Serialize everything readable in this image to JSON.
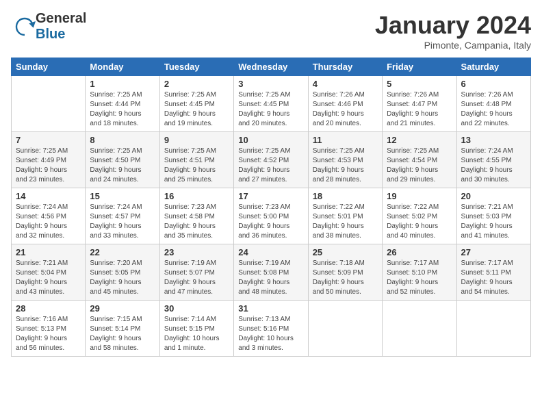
{
  "header": {
    "logo_general": "General",
    "logo_blue": "Blue",
    "month_title": "January 2024",
    "location": "Pimonte, Campania, Italy"
  },
  "days_of_week": [
    "Sunday",
    "Monday",
    "Tuesday",
    "Wednesday",
    "Thursday",
    "Friday",
    "Saturday"
  ],
  "weeks": [
    [
      {
        "day": "",
        "info": ""
      },
      {
        "day": "1",
        "info": "Sunrise: 7:25 AM\nSunset: 4:44 PM\nDaylight: 9 hours\nand 18 minutes."
      },
      {
        "day": "2",
        "info": "Sunrise: 7:25 AM\nSunset: 4:45 PM\nDaylight: 9 hours\nand 19 minutes."
      },
      {
        "day": "3",
        "info": "Sunrise: 7:25 AM\nSunset: 4:45 PM\nDaylight: 9 hours\nand 20 minutes."
      },
      {
        "day": "4",
        "info": "Sunrise: 7:26 AM\nSunset: 4:46 PM\nDaylight: 9 hours\nand 20 minutes."
      },
      {
        "day": "5",
        "info": "Sunrise: 7:26 AM\nSunset: 4:47 PM\nDaylight: 9 hours\nand 21 minutes."
      },
      {
        "day": "6",
        "info": "Sunrise: 7:26 AM\nSunset: 4:48 PM\nDaylight: 9 hours\nand 22 minutes."
      }
    ],
    [
      {
        "day": "7",
        "info": "Sunrise: 7:25 AM\nSunset: 4:49 PM\nDaylight: 9 hours\nand 23 minutes."
      },
      {
        "day": "8",
        "info": "Sunrise: 7:25 AM\nSunset: 4:50 PM\nDaylight: 9 hours\nand 24 minutes."
      },
      {
        "day": "9",
        "info": "Sunrise: 7:25 AM\nSunset: 4:51 PM\nDaylight: 9 hours\nand 25 minutes."
      },
      {
        "day": "10",
        "info": "Sunrise: 7:25 AM\nSunset: 4:52 PM\nDaylight: 9 hours\nand 27 minutes."
      },
      {
        "day": "11",
        "info": "Sunrise: 7:25 AM\nSunset: 4:53 PM\nDaylight: 9 hours\nand 28 minutes."
      },
      {
        "day": "12",
        "info": "Sunrise: 7:25 AM\nSunset: 4:54 PM\nDaylight: 9 hours\nand 29 minutes."
      },
      {
        "day": "13",
        "info": "Sunrise: 7:24 AM\nSunset: 4:55 PM\nDaylight: 9 hours\nand 30 minutes."
      }
    ],
    [
      {
        "day": "14",
        "info": "Sunrise: 7:24 AM\nSunset: 4:56 PM\nDaylight: 9 hours\nand 32 minutes."
      },
      {
        "day": "15",
        "info": "Sunrise: 7:24 AM\nSunset: 4:57 PM\nDaylight: 9 hours\nand 33 minutes."
      },
      {
        "day": "16",
        "info": "Sunrise: 7:23 AM\nSunset: 4:58 PM\nDaylight: 9 hours\nand 35 minutes."
      },
      {
        "day": "17",
        "info": "Sunrise: 7:23 AM\nSunset: 5:00 PM\nDaylight: 9 hours\nand 36 minutes."
      },
      {
        "day": "18",
        "info": "Sunrise: 7:22 AM\nSunset: 5:01 PM\nDaylight: 9 hours\nand 38 minutes."
      },
      {
        "day": "19",
        "info": "Sunrise: 7:22 AM\nSunset: 5:02 PM\nDaylight: 9 hours\nand 40 minutes."
      },
      {
        "day": "20",
        "info": "Sunrise: 7:21 AM\nSunset: 5:03 PM\nDaylight: 9 hours\nand 41 minutes."
      }
    ],
    [
      {
        "day": "21",
        "info": "Sunrise: 7:21 AM\nSunset: 5:04 PM\nDaylight: 9 hours\nand 43 minutes."
      },
      {
        "day": "22",
        "info": "Sunrise: 7:20 AM\nSunset: 5:05 PM\nDaylight: 9 hours\nand 45 minutes."
      },
      {
        "day": "23",
        "info": "Sunrise: 7:19 AM\nSunset: 5:07 PM\nDaylight: 9 hours\nand 47 minutes."
      },
      {
        "day": "24",
        "info": "Sunrise: 7:19 AM\nSunset: 5:08 PM\nDaylight: 9 hours\nand 48 minutes."
      },
      {
        "day": "25",
        "info": "Sunrise: 7:18 AM\nSunset: 5:09 PM\nDaylight: 9 hours\nand 50 minutes."
      },
      {
        "day": "26",
        "info": "Sunrise: 7:17 AM\nSunset: 5:10 PM\nDaylight: 9 hours\nand 52 minutes."
      },
      {
        "day": "27",
        "info": "Sunrise: 7:17 AM\nSunset: 5:11 PM\nDaylight: 9 hours\nand 54 minutes."
      }
    ],
    [
      {
        "day": "28",
        "info": "Sunrise: 7:16 AM\nSunset: 5:13 PM\nDaylight: 9 hours\nand 56 minutes."
      },
      {
        "day": "29",
        "info": "Sunrise: 7:15 AM\nSunset: 5:14 PM\nDaylight: 9 hours\nand 58 minutes."
      },
      {
        "day": "30",
        "info": "Sunrise: 7:14 AM\nSunset: 5:15 PM\nDaylight: 10 hours\nand 1 minute."
      },
      {
        "day": "31",
        "info": "Sunrise: 7:13 AM\nSunset: 5:16 PM\nDaylight: 10 hours\nand 3 minutes."
      },
      {
        "day": "",
        "info": ""
      },
      {
        "day": "",
        "info": ""
      },
      {
        "day": "",
        "info": ""
      }
    ]
  ]
}
